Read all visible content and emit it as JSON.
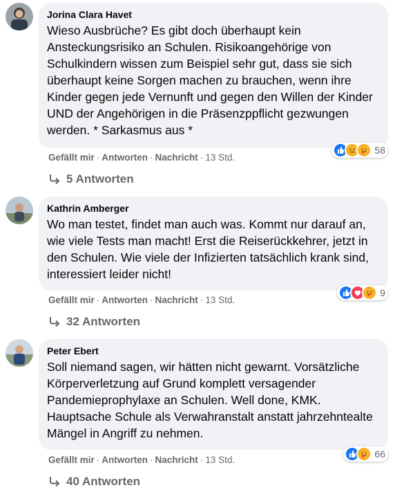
{
  "comments": [
    {
      "author": "Jorina Clara Havet",
      "text": "Wieso Ausbrüche? Es gibt doch überhaupt kein Ansteckungsrisiko an Schulen. Risikoangehörige von Schulkindern wissen zum Beispiel sehr gut, dass sie sich überhaupt keine Sorgen machen zu brauchen, wenn ihre Kinder gegen jede Vernunft und gegen den Willen der Kinder UND der Angehörigen in die Präsenzppflicht gezwungen werden. * Sarkasmus aus *",
      "reaction_count": "58",
      "reactions": [
        "like-icon",
        "sad-icon",
        "care-icon"
      ],
      "like": "Gefällt mir",
      "reply": "Antworten",
      "message": "Nachricht",
      "time": "13 Std.",
      "replies": "5 Antworten"
    },
    {
      "author": "Kathrin Amberger",
      "text": "Wo man testet, findet man auch was. Kommt nur darauf an, wie viele Tests man macht! Erst die Reiserückkehrer, jetzt in den Schulen. Wie viele der Infizierten tatsächlich krank sind, interessiert leider nicht!",
      "reaction_count": "9",
      "reactions": [
        "like-icon",
        "love-icon",
        "care-icon"
      ],
      "like": "Gefällt mir",
      "reply": "Antworten",
      "message": "Nachricht",
      "time": "13 Std.",
      "replies": "32 Antworten"
    },
    {
      "author": "Peter Ebert",
      "text": "Soll niemand sagen, wir hätten nicht gewarnt. Vorsätzliche Körperverletzung auf Grund komplett versagender Pandemieprophylaxe an Schulen. Well done, KMK. Hauptsache Schule als Verwahranstalt anstatt jahrzehntealte Mängel in Angriff zu nehmen.",
      "reaction_count": "66",
      "reactions": [
        "like-icon",
        "care-icon"
      ],
      "like": "Gefällt mir",
      "reply": "Antworten",
      "message": "Nachricht",
      "time": "13 Std.",
      "replies": "40 Antworten"
    }
  ],
  "colors": {
    "bubble": "#f0f2f5",
    "muted": "#65676b",
    "like": "#1877f2",
    "love": "#f33e58",
    "sad": "#f7b125"
  }
}
